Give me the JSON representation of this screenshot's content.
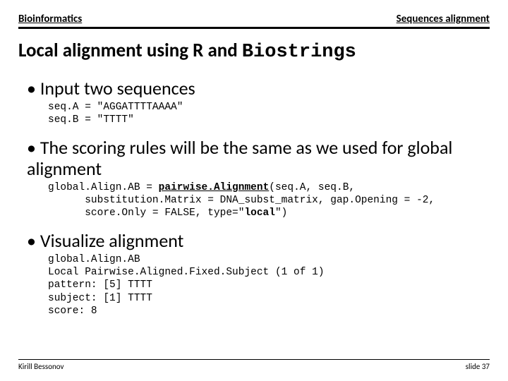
{
  "header": {
    "left": "Bioinformatics",
    "right": "Sequences alignment"
  },
  "title": {
    "prefix": "Local alignment using R and ",
    "package": "Biostrings"
  },
  "bullets": {
    "b1": {
      "text": "Input two sequences",
      "code": "seq.A = \"AGGATTTTAAAA\"\nseq.B = \"TTTT\""
    },
    "b2": {
      "text": "The scoring rules will be the same as we used for global alignment",
      "code_pre": "global.Align.AB = ",
      "code_fn": "pairwise.Alignment",
      "code_mid": "(seq.A, seq.B,\n      substitution.Matrix = DNA_subst_matrix, gap.Opening = -2,\n      score.Only = FALSE, type=\"",
      "code_local": "local",
      "code_post": "\")"
    },
    "b3": {
      "text": "Visualize alignment",
      "code": "global.Align.AB\nLocal Pairwise.Aligned.Fixed.Subject (1 of 1)\npattern: [5] TTTT\nsubject: [1] TTTT\nscore: 8"
    }
  },
  "footer": {
    "author": "Kirill Bessonov",
    "page": "slide 37"
  }
}
